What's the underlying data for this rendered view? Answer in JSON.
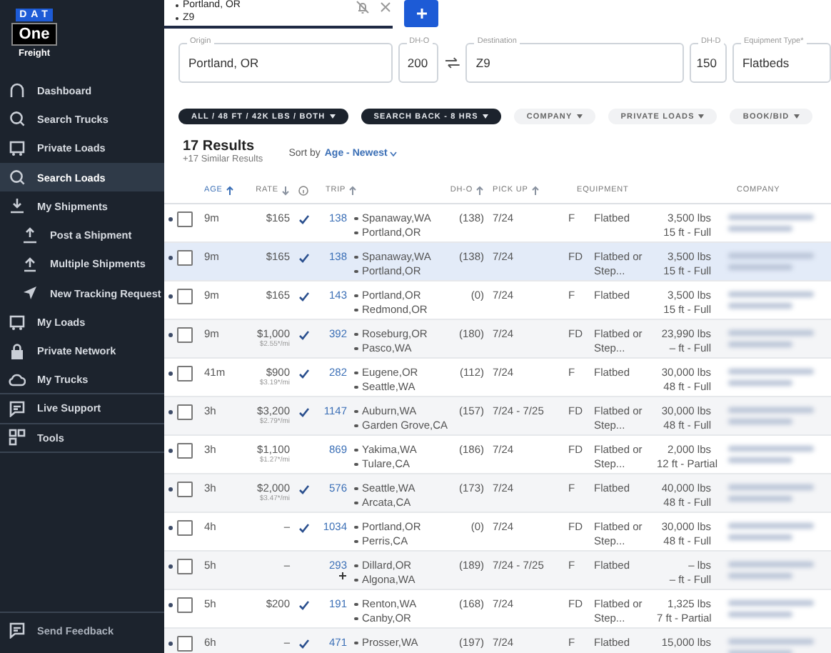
{
  "logo": {
    "top": "DAT",
    "middle": "One",
    "bottom": "Freight"
  },
  "sidebar": {
    "items": [
      {
        "label": "Dashboard",
        "kind": "item",
        "selected": false
      },
      {
        "label": "Search Trucks",
        "kind": "item",
        "selected": false
      },
      {
        "label": "Private Loads",
        "kind": "item",
        "selected": false
      },
      {
        "label": "Search Loads",
        "kind": "item",
        "selected": true
      },
      {
        "label": "My Shipments",
        "kind": "item",
        "selected": false
      },
      {
        "label": "Post a Shipment",
        "kind": "sub",
        "selected": false
      },
      {
        "label": "Multiple Shipments",
        "kind": "sub",
        "selected": false
      },
      {
        "label": "New Tracking Request",
        "kind": "sub",
        "selected": false
      },
      {
        "label": "My Loads",
        "kind": "item",
        "selected": false
      },
      {
        "label": "Private Network",
        "kind": "item",
        "selected": false
      },
      {
        "label": "My Trucks",
        "kind": "item",
        "selected": false
      },
      {
        "label": "Live Support",
        "kind": "item",
        "selected": false
      },
      {
        "label": "Tools",
        "kind": "item",
        "selected": false
      }
    ],
    "footer": "Send Feedback"
  },
  "search_tab": {
    "origin": "Portland, OR",
    "destination": "Z9"
  },
  "fields": [
    {
      "label": "Origin",
      "value": "Portland, OR",
      "kind": "text"
    },
    {
      "label": "DH-O",
      "value": "200",
      "kind": "num"
    },
    {
      "label": "Destination",
      "value": "Z9",
      "kind": "text"
    },
    {
      "label": "DH-D",
      "value": "150",
      "kind": "num"
    },
    {
      "label": "Equipment Type*",
      "value": "Flatbeds",
      "kind": "text"
    }
  ],
  "filters": [
    {
      "label": "ALL / 48 FT / 42K LBS / BOTH",
      "selected": true
    },
    {
      "label": "SEARCH BACK - 8 HRS",
      "selected": true
    },
    {
      "label": "COMPANY",
      "selected": false
    },
    {
      "label": "PRIVATE LOADS",
      "selected": false
    },
    {
      "label": "BOOK/BID",
      "selected": false
    }
  ],
  "results": {
    "count": "17 Results",
    "similar": "+17 Similar Results",
    "sort_label": "Sort by",
    "sort_value": "Age - Newest"
  },
  "table": {
    "columns": [
      {
        "label": "AGE",
        "kind": "sort_up",
        "selected": true
      },
      {
        "label": "RATE",
        "kind": "sort_down",
        "selected": false
      },
      {
        "kind": "info"
      },
      {
        "label": "TRIP",
        "kind": "sort_up",
        "selected": false
      },
      {
        "label": "DH-O",
        "kind": "sort_up",
        "selected": false
      },
      {
        "label": "PICK UP",
        "kind": "sort_up",
        "selected": false
      },
      {
        "label": "EQUIPMENT",
        "kind": "plain",
        "selected": false
      },
      {
        "label": "COMPANY",
        "kind": "plain",
        "selected": false
      }
    ],
    "rows": [
      {
        "age": "9m",
        "rate": "$165",
        "booked": true,
        "trip": "138",
        "origin": "Spanaway,WA",
        "destination": "Portland,OR",
        "dh_o": "(138)",
        "pickup": "7/24",
        "code": "F",
        "equipment": "Flatbed",
        "weight": "3,500 lbs",
        "length": "15 ft - Full",
        "selected": false
      },
      {
        "age": "9m",
        "rate": "$165",
        "booked": true,
        "trip": "138",
        "origin": "Spanaway,WA",
        "destination": "Portland,OR",
        "dh_o": "(138)",
        "pickup": "7/24",
        "code": "FD",
        "equipment": "Flatbed or Step...",
        "weight": "3,500 lbs",
        "length": "15 ft - Full",
        "selected": true
      },
      {
        "age": "9m",
        "rate": "$165",
        "booked": true,
        "trip": "143",
        "origin": "Portland,OR",
        "destination": "Redmond,OR",
        "dh_o": "(0)",
        "pickup": "7/24",
        "code": "F",
        "equipment": "Flatbed",
        "weight": "3,500 lbs",
        "length": "15 ft - Full",
        "selected": false
      },
      {
        "age": "9m",
        "rate": "$1,000",
        "per_mile": "$2.55*/mi",
        "booked": true,
        "trip": "392",
        "origin": "Roseburg,OR",
        "destination": "Pasco,WA",
        "dh_o": "(180)",
        "pickup": "7/24",
        "code": "FD",
        "equipment": "Flatbed or Step...",
        "weight": "23,990 lbs",
        "length": "– ft - Full",
        "selected": false
      },
      {
        "age": "41m",
        "rate": "$900",
        "per_mile": "$3.19*/mi",
        "booked": true,
        "trip": "282",
        "origin": "Eugene,OR",
        "destination": "Seattle,WA",
        "dh_o": "(112)",
        "pickup": "7/24",
        "code": "F",
        "equipment": "Flatbed",
        "weight": "30,000 lbs",
        "length": "48 ft - Full",
        "selected": false
      },
      {
        "age": "3h",
        "rate": "$3,200",
        "per_mile": "$2.79*/mi",
        "booked": true,
        "trip": "1147",
        "origin": "Auburn,WA",
        "destination": "Garden Grove,CA",
        "dh_o": "(157)",
        "pickup": "7/24 - 7/25",
        "code": "FD",
        "equipment": "Flatbed or Step...",
        "weight": "30,000 lbs",
        "length": "48 ft - Full",
        "selected": false
      },
      {
        "age": "3h",
        "rate": "$1,100",
        "per_mile": "$1.27*/mi",
        "booked": false,
        "trip": "869",
        "origin": "Yakima,WA",
        "destination": "Tulare,CA",
        "dh_o": "(186)",
        "pickup": "7/24",
        "code": "FD",
        "equipment": "Flatbed or Step...",
        "weight": "2,000 lbs",
        "length": "12 ft - Partial",
        "selected": false
      },
      {
        "age": "3h",
        "rate": "$2,000",
        "per_mile": "$3.47*/mi",
        "booked": true,
        "trip": "576",
        "origin": "Seattle,WA",
        "destination": "Arcata,CA",
        "dh_o": "(173)",
        "pickup": "7/24",
        "code": "F",
        "equipment": "Flatbed",
        "weight": "40,000 lbs",
        "length": "48 ft - Full",
        "selected": false
      },
      {
        "age": "4h",
        "rate": "–",
        "booked": true,
        "trip": "1034",
        "origin": "Portland,OR",
        "destination": "Perris,CA",
        "dh_o": "(0)",
        "pickup": "7/24",
        "code": "FD",
        "equipment": "Flatbed or Step...",
        "weight": "30,000 lbs",
        "length": "48 ft - Full",
        "selected": false
      },
      {
        "age": "5h",
        "rate": "–",
        "booked": false,
        "trip": "293",
        "origin": "Dillard,OR",
        "destination": "Algona,WA",
        "dh_o": "(189)",
        "pickup": "7/24 - 7/25",
        "code": "F",
        "equipment": "Flatbed",
        "weight": "– lbs",
        "length": "– ft - Full",
        "selected": false
      },
      {
        "age": "5h",
        "rate": "$200",
        "booked": true,
        "trip": "191",
        "origin": "Renton,WA",
        "destination": "Canby,OR",
        "dh_o": "(168)",
        "pickup": "7/24",
        "code": "FD",
        "equipment": "Flatbed or Step...",
        "weight": "1,325 lbs",
        "length": "7 ft - Partial",
        "selected": false
      },
      {
        "age": "6h",
        "rate": "–",
        "booked": true,
        "trip": "471",
        "origin": "Prosser,WA",
        "dh_o": "(197)",
        "pickup": "7/24",
        "code": "F",
        "equipment": "Flatbed",
        "weight": "15,000 lbs",
        "selected": false
      }
    ]
  }
}
